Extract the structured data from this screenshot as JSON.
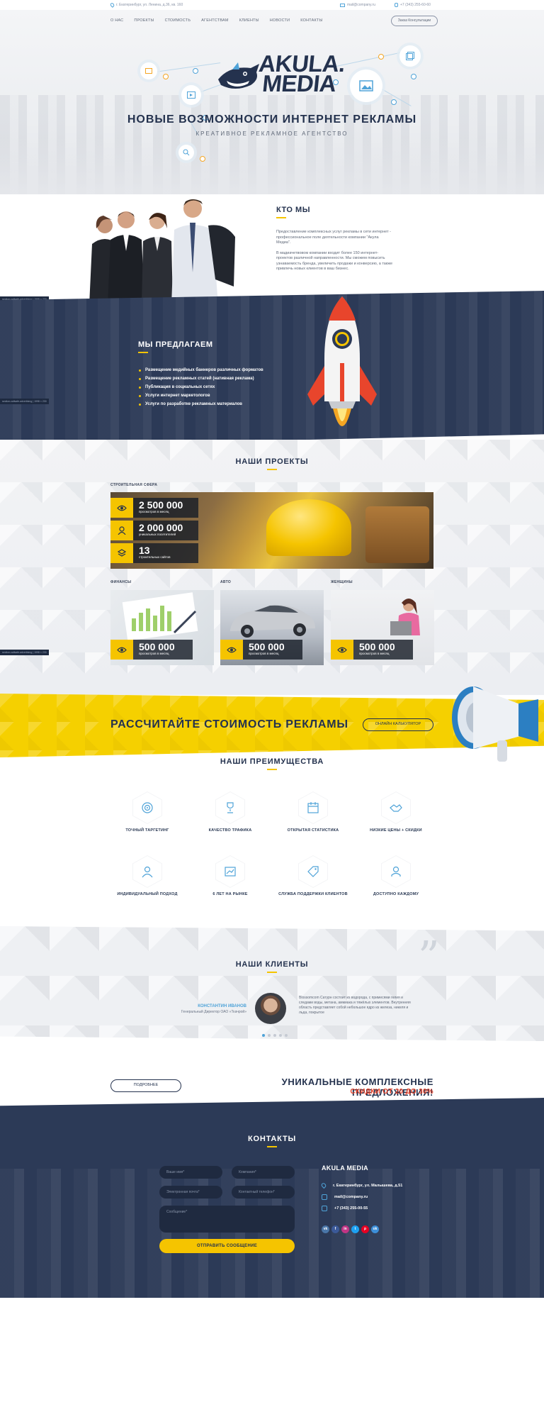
{
  "topbar": {
    "address": "г. Екатеринбург, ул. Ленина, д.36, кв. 160",
    "email": "mail@company.ru",
    "phone": "+7 (343) 255-60-60"
  },
  "nav": {
    "items": [
      "О НАС",
      "ПРОЕКТЫ",
      "СТОИМОСТЬ",
      "АГЕНТСТВАМ",
      "КЛИЕНТЫ",
      "НОВОСТИ",
      "КОНТАКТЫ"
    ],
    "cta": "Заказ Консультации"
  },
  "hero": {
    "logo_line1": "AKULA.",
    "logo_line2": "MEDIA",
    "title": "НОВЫЕ ВОЗМОЖНОСТИ ИНТЕРНЕТ РЕКЛАМЫ",
    "subtitle": "КРЕАТИВНОЕ РЕКЛАМНОЕ АГЕНТСТВО"
  },
  "who": {
    "title": "КТО МЫ",
    "p1": "Предоставление комплексных услуг рекламы в сети интернет - профессиональное поле деятельности компании \"Акула Медиа\".",
    "p2": "В мадиачетвовом компании входит более 150 интернет-проектов различной направленности. Мы сможем повысить узнаваемость бренда, увеличить продажи и конверсию, а также привлечь новых клиентов в ваш бизнес."
  },
  "offer": {
    "title": "МЫ ПРЕДЛАГАЕМ",
    "items": [
      "Размещение медийных баннеров различных форматов",
      "Размещение рекламных статей (нативная реклама)",
      "Публикация в социальных сетях",
      "Услуги интернет маркетологов",
      "Услуги по разработке рекламных материалов"
    ],
    "dim_tag": "section-callsafe-advertising | 1998 × 230"
  },
  "projects": {
    "title": "НАШИ ПРОЕКТЫ",
    "big_category": "СТРОИТЕЛЬНАЯ СФЕРА",
    "big_stats": [
      {
        "num": "2 500 000",
        "lbl": "просмотров в месяц"
      },
      {
        "num": "2 000 000",
        "lbl": "уникальных посетителей"
      },
      {
        "num": "13",
        "lbl": "строительных сайтов"
      }
    ],
    "cards": [
      {
        "category": "ФИНАНСЫ",
        "num": "500 000",
        "lbl": "просмотров в месяц"
      },
      {
        "category": "АВТО",
        "num": "500 000",
        "lbl": "просмотров в месяц"
      },
      {
        "category": "ЖЕНЩИНЫ",
        "num": "500 000",
        "lbl": "просмотров в месяц"
      }
    ]
  },
  "calc": {
    "title": "РАССЧИТАЙТЕ СТОИМОСТЬ РЕКЛАМЫ",
    "button": "ОНЛАЙН КАЛЬКУЛЯТОР"
  },
  "advantages": {
    "title": "НАШИ ПРЕИМУЩЕСТВА",
    "items": [
      {
        "label": "ТОЧНЫЙ ТАРГЕТИНГ",
        "icon": "target-icon"
      },
      {
        "label": "КАЧЕСТВО ТРАФИКА",
        "icon": "trophy-icon"
      },
      {
        "label": "ОТКРЫТАЯ СТАТИСТИКА",
        "icon": "calendar-icon"
      },
      {
        "label": "НИЗКИЕ ЦЕНЫ + СКИДКИ",
        "icon": "handshake-icon"
      },
      {
        "label": "ИНДИВИДУАЛЬНЫЙ ПОДХОД",
        "icon": "person-icon"
      },
      {
        "label": "6 ЛЕТ НА РЫНКЕ",
        "icon": "chart-icon"
      },
      {
        "label": "СЛУЖБА ПОДДЕРЖКИ КЛИЕНТОВ",
        "icon": "tag-icon"
      },
      {
        "label": "ДОСТУПНО КАЖДОМУ",
        "icon": "user-icon"
      }
    ]
  },
  "clients": {
    "title": "НАШИ КЛИЕНТЫ",
    "name": "КОНСТАНТИН ИВАНОВ",
    "position": "Генеральный Директор ОАО «Ткачрой»",
    "text": "Blossomcom Сатурн состоит из водорода, с примесями гелия и следами воды, метана, аммиака и тяжёлых элементов. Внутренняя область представляет собой небольшое ядро из железа, никеля и льда, покрытое"
  },
  "unique": {
    "button": "ПОДРОБНЕЕ",
    "title": "УНИКАЛЬНЫЕ КОМПЛЕКСНЫЕ ПРЕДЛОЖЕНИЯ!",
    "subtitle": "СКИДКИ ОТ 20 ДО 30%"
  },
  "contacts": {
    "title": "КОНТАКТЫ",
    "name_ph": "Ваше имя*",
    "company_ph": "Компания*",
    "phone_ph": "Электронная почта*",
    "email_ph": "Контактный телефон*",
    "message_ph": "Сообщение*",
    "send": "ОТПРАВИТЬ СООБЩЕНИЕ",
    "brand": "AKULA MEDIA",
    "address": "г. Екатеринбург, ул. Малышева, д.51",
    "email": "mail@company.ru",
    "phone": "+7 (343) 255-00-55",
    "socials": [
      "vk",
      "f",
      "in",
      "t",
      "p",
      "ok"
    ]
  },
  "colors": {
    "navy": "#2c3a57",
    "yellow": "#f5c400",
    "accent_blue": "#4fa3d8",
    "red": "#e8452c"
  }
}
